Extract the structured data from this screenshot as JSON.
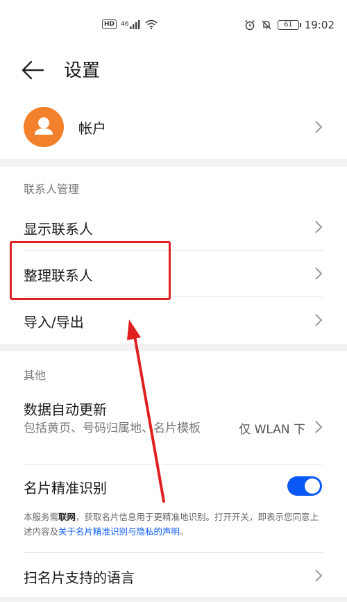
{
  "status_bar": {
    "hd": "HD",
    "network": "46",
    "battery": "61",
    "time": "19:02"
  },
  "header": {
    "title": "设置"
  },
  "account": {
    "label": "帐户"
  },
  "contacts_section": {
    "header": "联系人管理",
    "items": [
      {
        "label": "显示联系人"
      },
      {
        "label": "整理联系人"
      },
      {
        "label": "导入/导出"
      }
    ]
  },
  "other_section": {
    "header": "其他",
    "data_update": {
      "title": "数据自动更新",
      "subtitle": "包括黄页、号码归属地、名片模板",
      "value": "仅 WLAN 下"
    },
    "card_recognition": {
      "title": "名片精准识别",
      "enabled": true,
      "notice_prefix": "本服务需",
      "notice_bold": "联网",
      "notice_mid": "，获取名片信息用于更精准地识别。打开开关，即表示您同意上述内容及",
      "notice_link": "关于名片精准识别与隐私的声明",
      "notice_suffix": "。"
    },
    "scan_languages": {
      "label": "扫名片支持的语言"
    }
  },
  "colors": {
    "accent": "#0a59f7",
    "avatar": "#f3812b",
    "annotation": "#e02020"
  }
}
